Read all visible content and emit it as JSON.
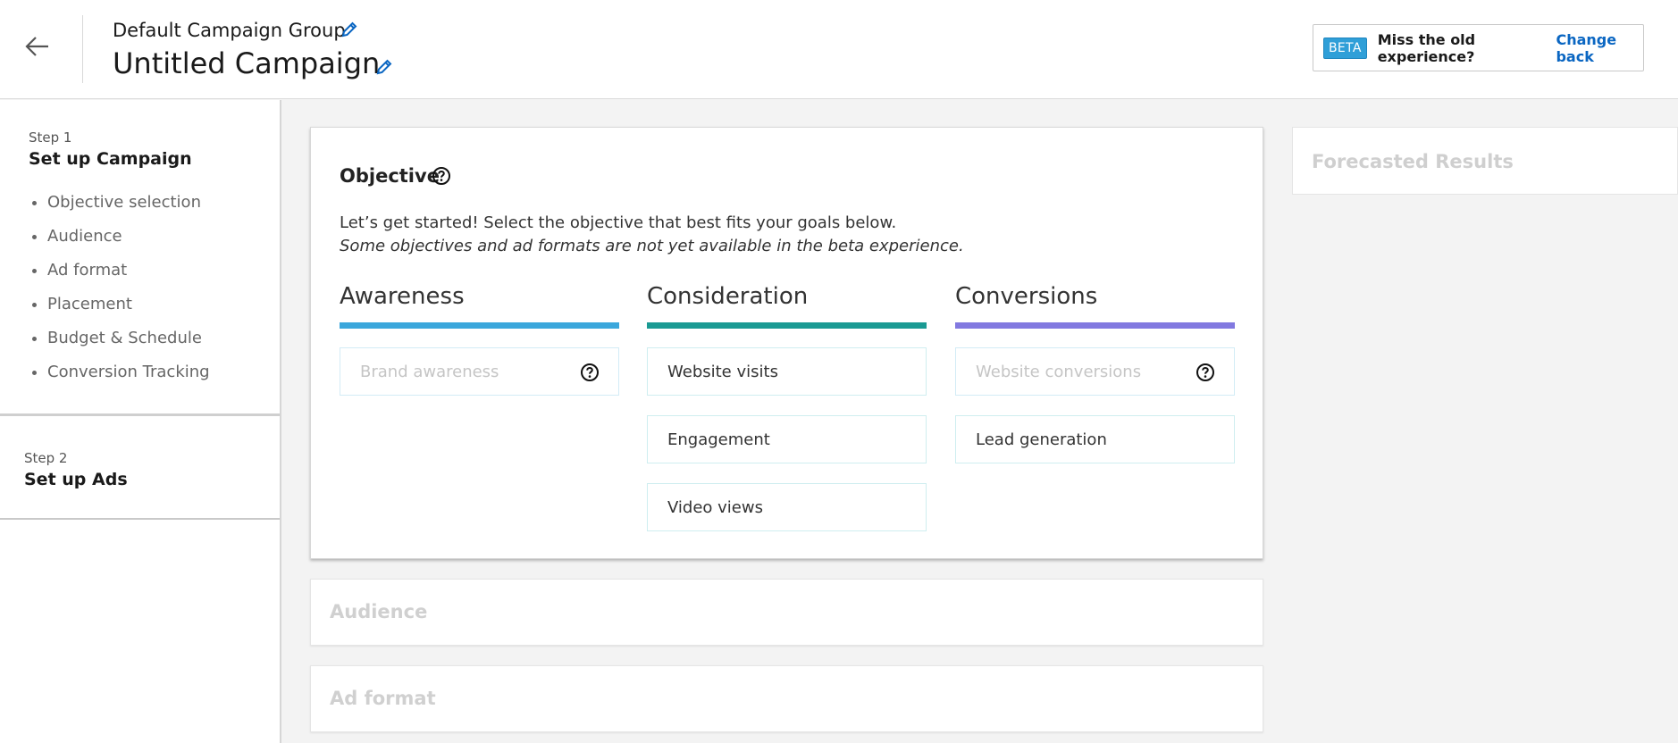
{
  "header": {
    "group_title": "Default Campaign Group",
    "campaign_title": "Untitled Campaign",
    "beta_badge": "BETA",
    "miss_text": "Miss the old experience?",
    "change_back": "Change back"
  },
  "sidebar": {
    "step1": {
      "label": "Step 1",
      "title": "Set up Campaign",
      "items": [
        "Objective selection",
        "Audience",
        "Ad format",
        "Placement",
        "Budget & Schedule",
        "Conversion Tracking"
      ]
    },
    "step2": {
      "label": "Step 2",
      "title": "Set up Ads"
    }
  },
  "objective": {
    "title": "Objective",
    "intro": "Let’s get started! Select the objective that best fits your goals below.",
    "note": "Some objectives and ad formats are not yet available in the beta experience.",
    "columns": [
      {
        "title": "Awareness",
        "color": "#3ba7dc",
        "options": [
          {
            "label": "Brand awareness",
            "disabled": true
          }
        ]
      },
      {
        "title": "Consideration",
        "color": "#1a9a93",
        "options": [
          {
            "label": "Website visits"
          },
          {
            "label": "Engagement"
          },
          {
            "label": "Video views"
          }
        ]
      },
      {
        "title": "Conversions",
        "color": "#8279e0",
        "options": [
          {
            "label": "Website conversions",
            "disabled": true
          },
          {
            "label": "Lead generation"
          }
        ]
      }
    ]
  },
  "sections": {
    "audience": "Audience",
    "ad_format": "Ad format",
    "forecast": "Forecasted Results"
  },
  "colors": {
    "accent_link": "#0a66c2",
    "beta_badge": "#2f9fd8"
  }
}
